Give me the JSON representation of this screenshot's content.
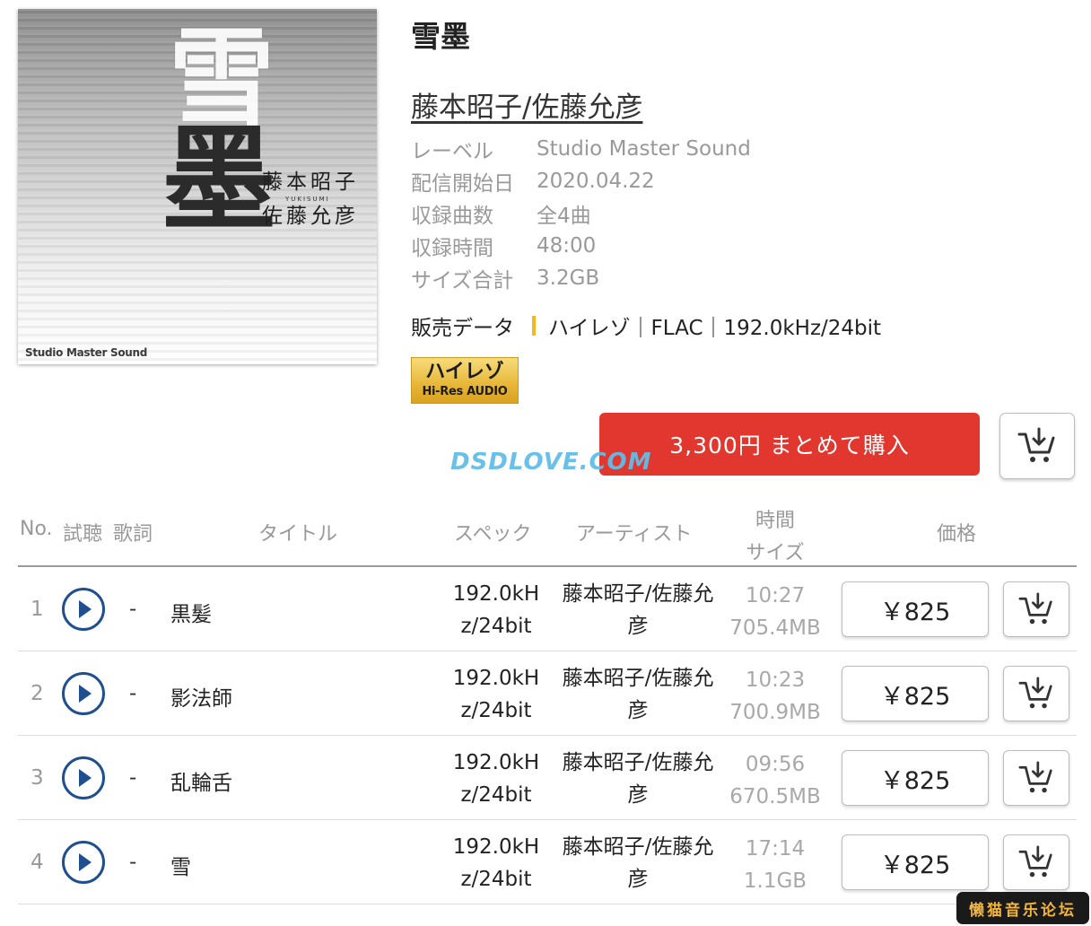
{
  "album": {
    "title": "雪墨",
    "artist": "藤本昭子/佐藤允彦",
    "cover": {
      "brush_char_top": "雪",
      "brush_char_bottom": "墨",
      "artist_line_1": "藤本昭子",
      "romaji": "YUKISUMI",
      "artist_line_2": "佐藤允彦",
      "label_mark": "Studio Master Sound"
    },
    "meta": [
      {
        "key": "レーベル",
        "value": "Studio Master Sound"
      },
      {
        "key": "配信開始日",
        "value": "2020.04.22"
      },
      {
        "key": "収録曲数",
        "value": "全4曲"
      },
      {
        "key": "収録時間",
        "value": "48:00"
      },
      {
        "key": "サイズ合計",
        "value": "3.2GB"
      }
    ],
    "sale_label": "販売データ",
    "sale_value": "ハイレゾ｜FLAC｜192.0kHz/24bit",
    "hires_badge": {
      "jp": "ハイレゾ",
      "en": "Hi-Res AUDIO"
    },
    "buy_all_label": "3,300円 まとめて購入"
  },
  "watermark": "DSDLOVE.COM",
  "table": {
    "headers": {
      "no": "No.",
      "preview": "試聴",
      "lyrics": "歌詞",
      "title": "タイトル",
      "spec": "スペック",
      "artist": "アーティスト",
      "time": "時間",
      "size": "サイズ",
      "price": "価格"
    },
    "rows": [
      {
        "no": "1",
        "lyrics": "-",
        "title": "黒髪",
        "spec": "192.0kHz/24bit",
        "artist": "藤本昭子/佐藤允彦",
        "time": "10:27",
        "size": "705.4MB",
        "price": "￥825"
      },
      {
        "no": "2",
        "lyrics": "-",
        "title": "影法師",
        "spec": "192.0kHz/24bit",
        "artist": "藤本昭子/佐藤允彦",
        "time": "10:23",
        "size": "700.9MB",
        "price": "￥825"
      },
      {
        "no": "3",
        "lyrics": "-",
        "title": "乱輪舌",
        "spec": "192.0kHz/24bit",
        "artist": "藤本昭子/佐藤允彦",
        "time": "09:56",
        "size": "670.5MB",
        "price": "￥825"
      },
      {
        "no": "4",
        "lyrics": "-",
        "title": "雪",
        "spec": "192.0kHz/24bit",
        "artist": "藤本昭子/佐藤允彦",
        "time": "17:14",
        "size": "1.1GB",
        "price": "￥825"
      }
    ]
  },
  "forum_badge": "懒猫音乐论坛",
  "colors": {
    "buy_button": "#e1372e",
    "hires_gold": "#e9b93c",
    "play_blue": "#1f4f8f",
    "watermark": "#62bde7"
  },
  "icons": {
    "play": "play-circle-icon",
    "cart": "cart-download-icon"
  }
}
